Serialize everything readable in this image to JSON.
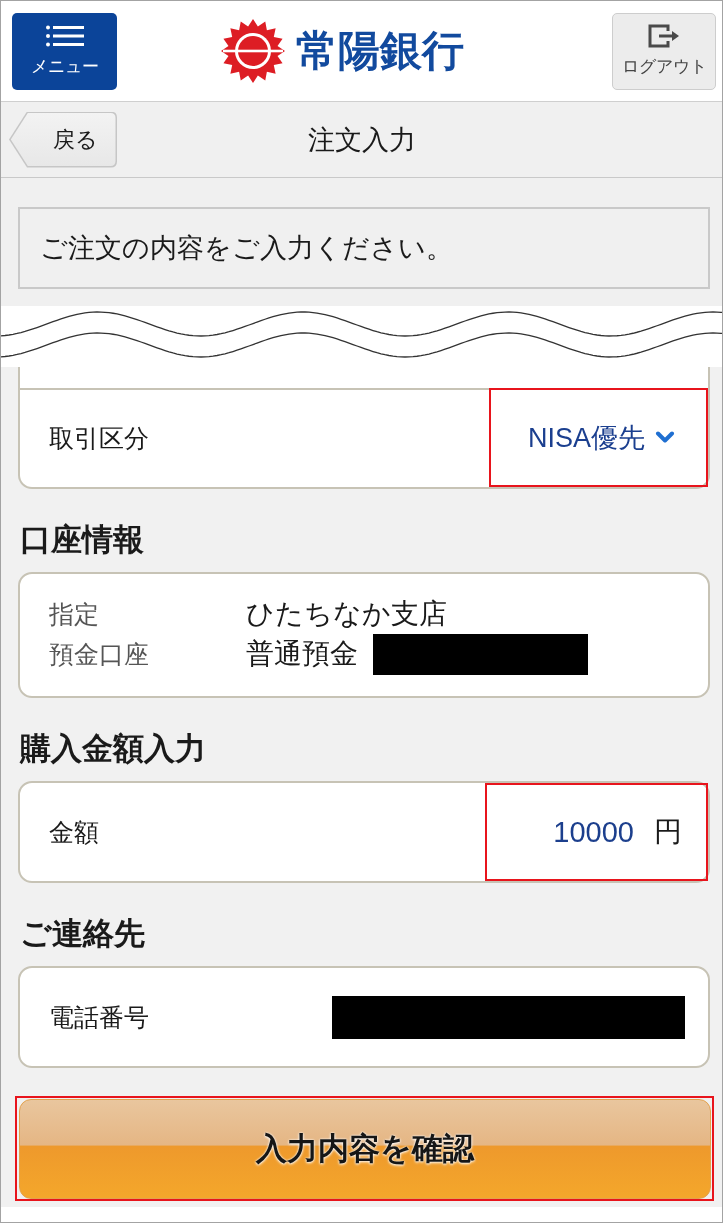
{
  "header": {
    "menu_button": {
      "label": "メニュー"
    },
    "logo": {
      "text": "常陽銀行"
    },
    "logout_button": {
      "label": "ログアウト"
    }
  },
  "nav": {
    "back_button": {
      "label": "戻る"
    },
    "title": "注文入力"
  },
  "message": "ご注文の内容をご入力ください。",
  "trade_type": {
    "label": "取引区分",
    "value": "NISA優先",
    "highlighted": true
  },
  "sections": [
    {
      "kind": "account",
      "heading": "口座情報",
      "labels": [
        "指定",
        "預金口座"
      ],
      "lines": [
        {
          "text": "ひたちなか支店",
          "redacted": false
        },
        {
          "text": "普通預金",
          "redacted": true
        }
      ]
    },
    {
      "kind": "amount",
      "heading": "購入金額入力",
      "label": "金額",
      "value": "10000",
      "unit": "円",
      "highlighted": true
    },
    {
      "kind": "contact",
      "heading": "ご連絡先",
      "label": "電話番号",
      "redacted": true
    }
  ],
  "confirm_button": {
    "label": "入力内容を確認",
    "highlighted": true
  }
}
